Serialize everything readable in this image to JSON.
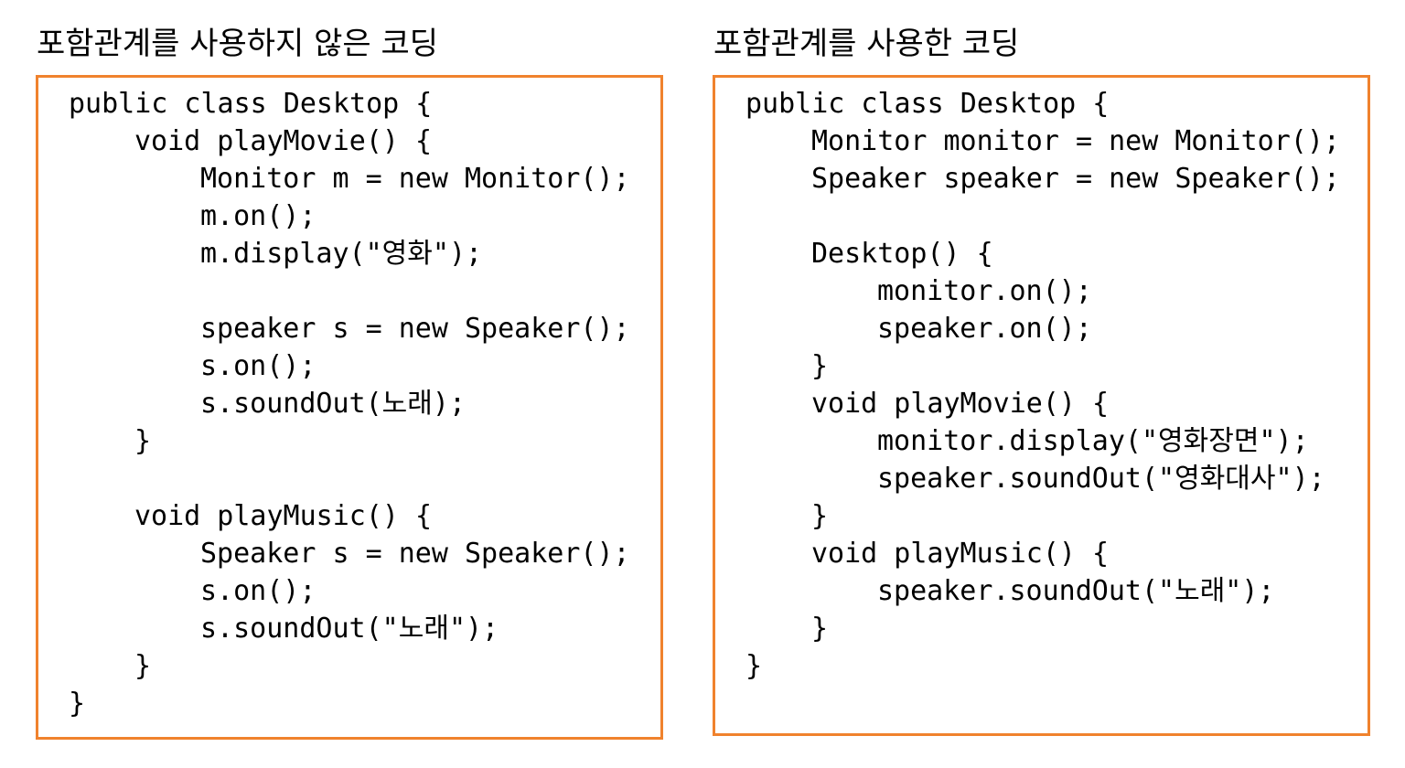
{
  "left_panel": {
    "title": "포함관계를 사용하지 않은 코딩",
    "lines": [
      {
        "indent": 0,
        "text": "public class Desktop {"
      },
      {
        "indent": 1,
        "text": "void playMovie() {"
      },
      {
        "indent": 2,
        "text": "Monitor m = new Monitor();"
      },
      {
        "indent": 2,
        "text": "m.on();"
      },
      {
        "indent": 2,
        "text": "m.display(\"영화\");"
      },
      {
        "indent": 0,
        "text": ""
      },
      {
        "indent": 2,
        "text": "speaker s = new Speaker();"
      },
      {
        "indent": 2,
        "text": "s.on();"
      },
      {
        "indent": 2,
        "text": "s.soundOut(노래);"
      },
      {
        "indent": 1,
        "text": "}"
      },
      {
        "indent": 0,
        "text": ""
      },
      {
        "indent": 1,
        "text": "void playMusic() {"
      },
      {
        "indent": 2,
        "text": "Speaker s = new Speaker();"
      },
      {
        "indent": 2,
        "text": "s.on();"
      },
      {
        "indent": 2,
        "text": "s.soundOut(\"노래\");"
      },
      {
        "indent": 1,
        "text": "}"
      },
      {
        "indent": 0,
        "text": "}"
      }
    ]
  },
  "right_panel": {
    "title": "포함관계를 사용한 코딩",
    "lines": [
      {
        "indent": 0,
        "text": "public class Desktop {"
      },
      {
        "indent": 1,
        "text": "Monitor monitor = new Monitor();"
      },
      {
        "indent": 1,
        "text": "Speaker speaker = new Speaker();"
      },
      {
        "indent": 0,
        "text": ""
      },
      {
        "indent": 1,
        "text": "Desktop() {"
      },
      {
        "indent": 2,
        "text": "monitor.on();"
      },
      {
        "indent": 2,
        "text": "speaker.on();"
      },
      {
        "indent": 1,
        "text": "}"
      },
      {
        "indent": 1,
        "text": "void playMovie() {"
      },
      {
        "indent": 2,
        "text": "monitor.display(\"영화장면\");"
      },
      {
        "indent": 2,
        "text": "speaker.soundOut(\"영화대사\");"
      },
      {
        "indent": 1,
        "text": "}"
      },
      {
        "indent": 1,
        "text": "void playMusic() {"
      },
      {
        "indent": 2,
        "text": "speaker.soundOut(\"노래\");"
      },
      {
        "indent": 1,
        "text": "}"
      },
      {
        "indent": 0,
        "text": "}"
      }
    ]
  },
  "colors": {
    "box_border": "#f0822d",
    "text": "#000000",
    "background": "#ffffff"
  }
}
